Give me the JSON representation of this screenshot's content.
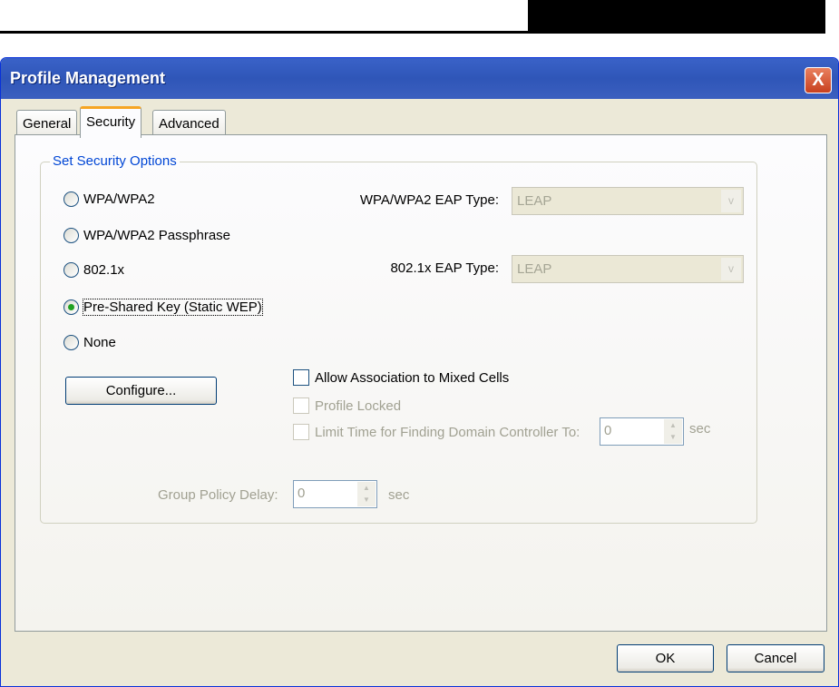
{
  "window": {
    "title": "Profile Management",
    "close": "X"
  },
  "tabs": [
    {
      "label": "General"
    },
    {
      "label": "Security"
    },
    {
      "label": "Advanced"
    }
  ],
  "group": {
    "label": "Set Security Options"
  },
  "radios": [
    {
      "label": "WPA/WPA2",
      "checked": false
    },
    {
      "label": "WPA/WPA2 Passphrase",
      "checked": false
    },
    {
      "label": "802.1x",
      "checked": false
    },
    {
      "label": "Pre-Shared Key (Static WEP)",
      "checked": true
    },
    {
      "label": "None",
      "checked": false
    }
  ],
  "wpa_eap": {
    "label": "WPA/WPA2 EAP Type:",
    "value": "LEAP",
    "arrow": "v"
  },
  "dot1x_eap": {
    "label": "802.1x EAP Type:",
    "value": "LEAP",
    "arrow": "v"
  },
  "configure": "Configure...",
  "checks": {
    "mixed": "Allow Association to Mixed Cells",
    "locked": "Profile Locked",
    "limit": "Limit Time for Finding Domain Controller To:"
  },
  "limit_value": "0",
  "limit_unit": "sec",
  "gpd": {
    "label": "Group Policy Delay:",
    "value": "0",
    "unit": "sec"
  },
  "spin_arrows": {
    "up": "▲",
    "down": "▼"
  },
  "buttons": {
    "ok": "OK",
    "cancel": "Cancel"
  }
}
